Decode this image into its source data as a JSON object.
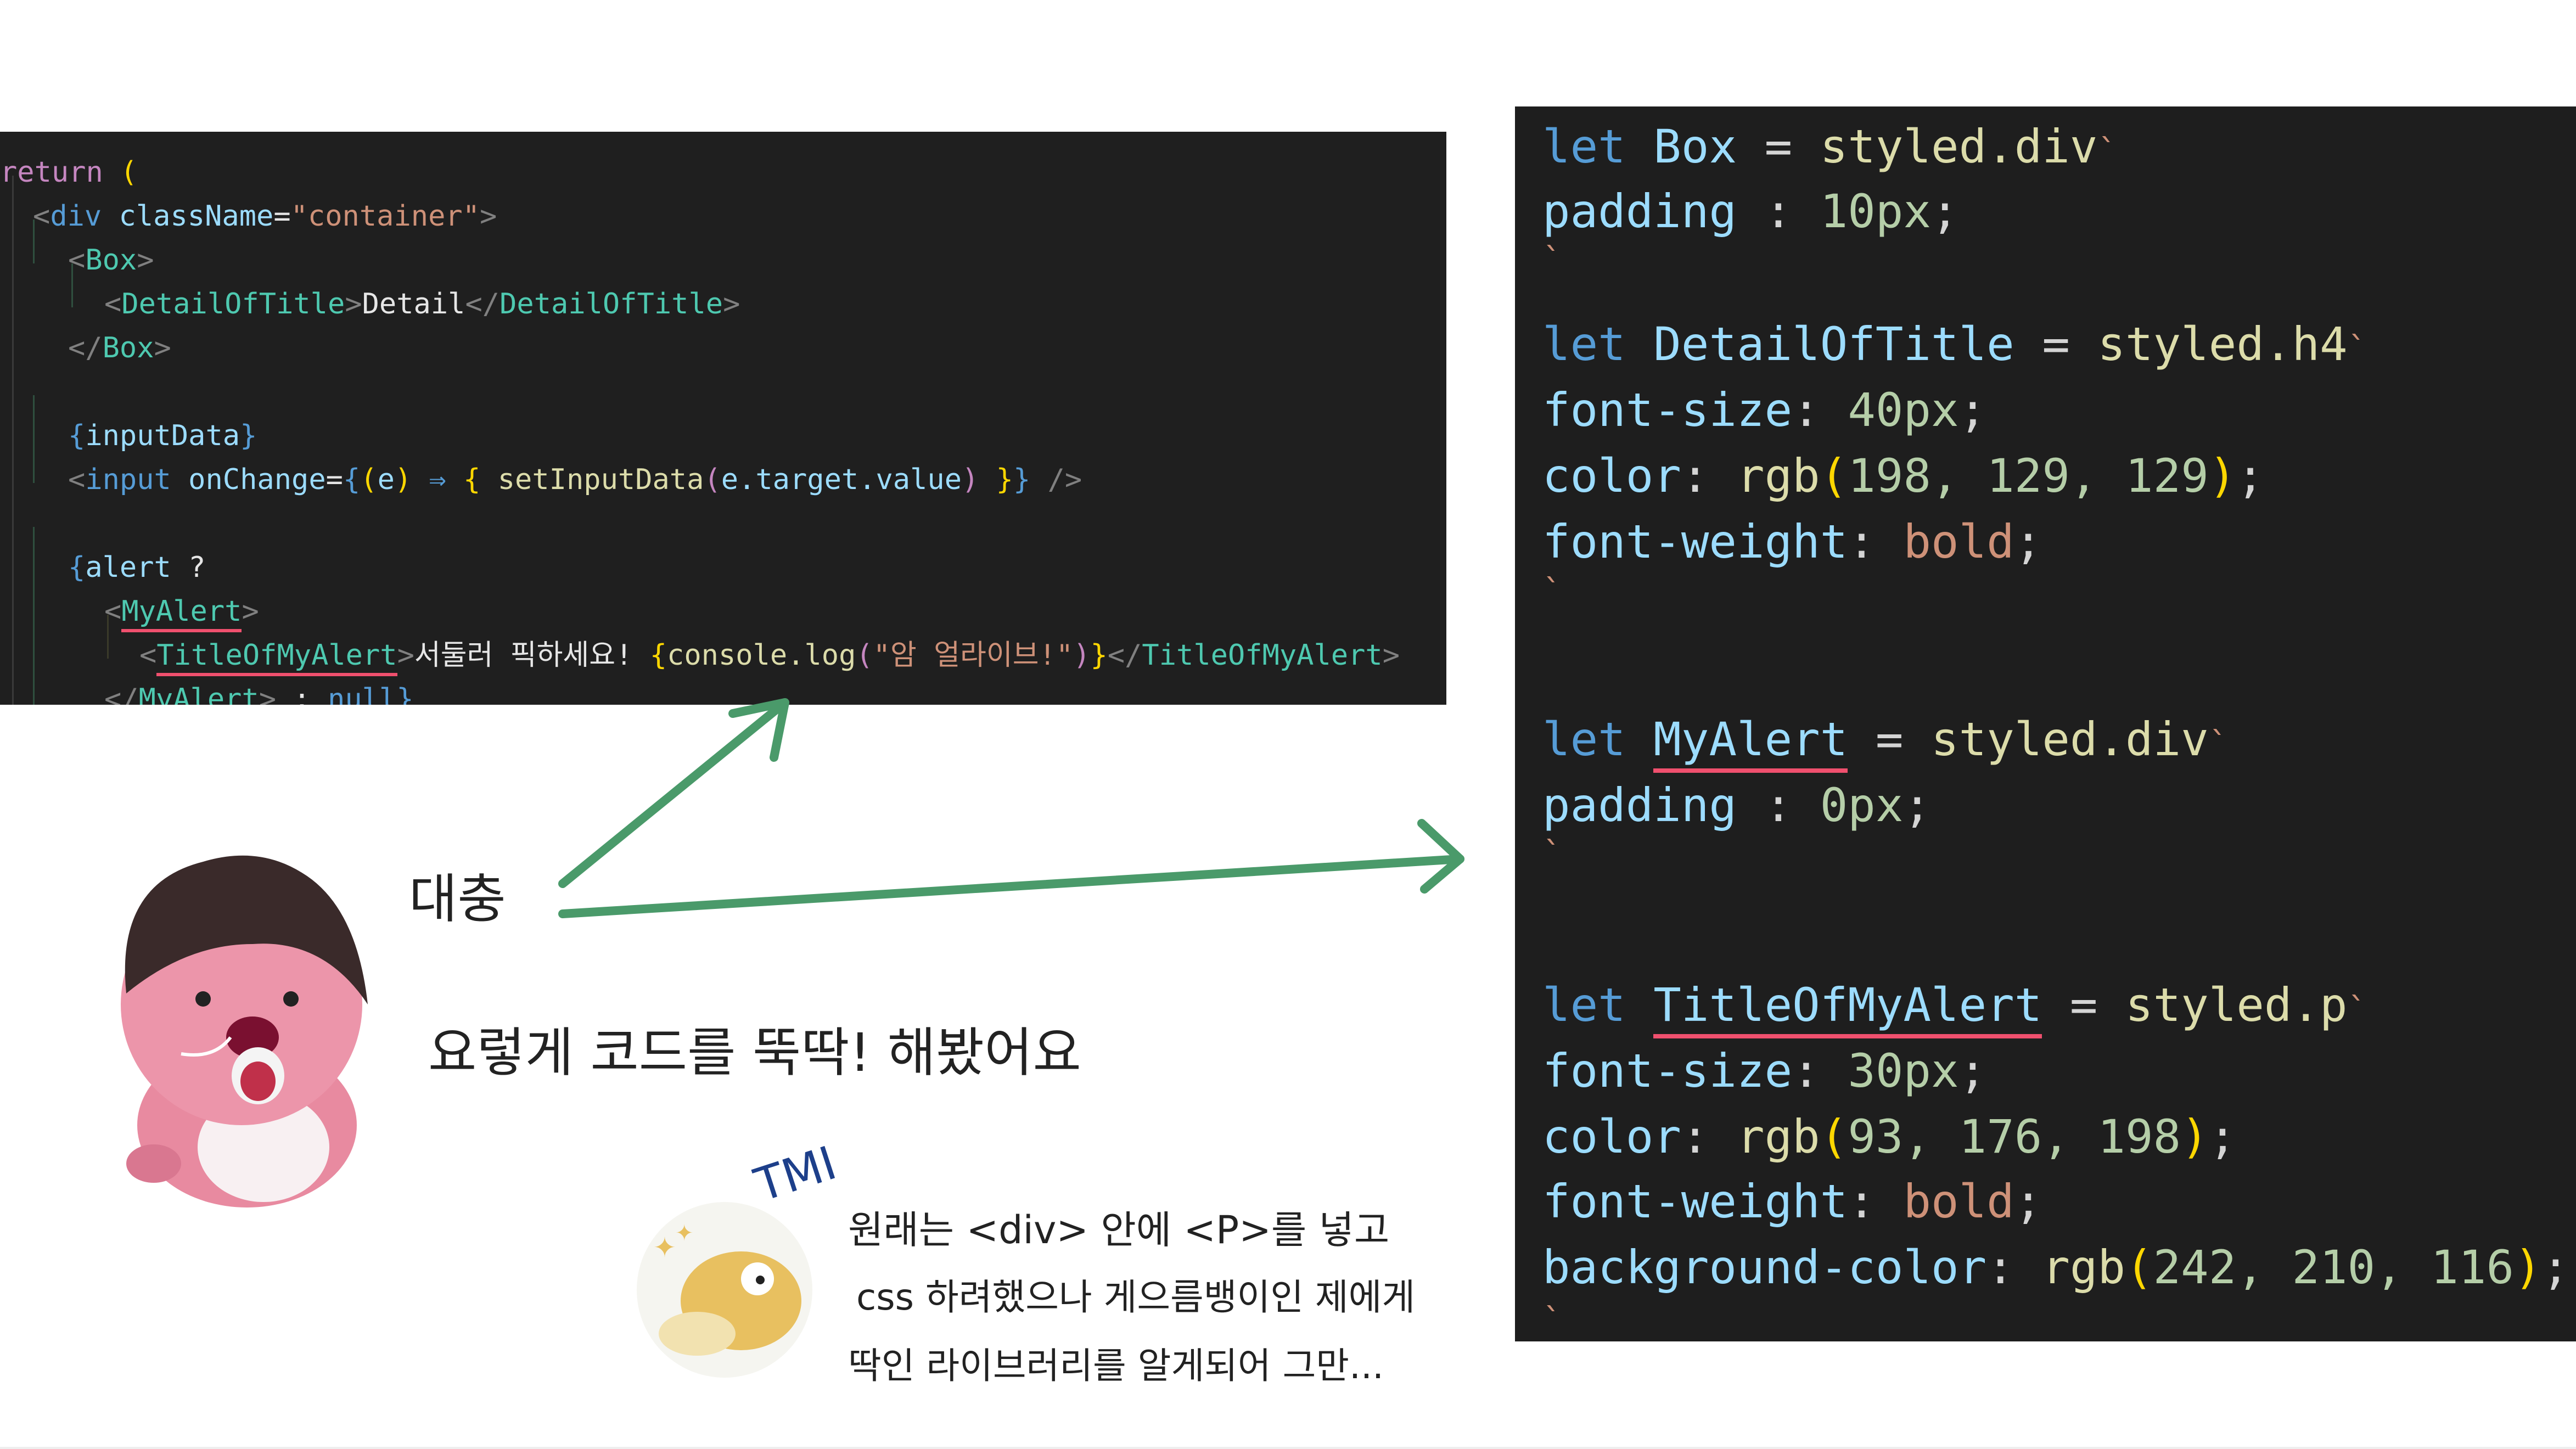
{
  "left_code": {
    "l1_kw": "return",
    "l1_p": " (",
    "l2_open": "<",
    "l2_tag": "div",
    "l2_attr": " className",
    "l2_eq": "=",
    "l2_str": "\"container\"",
    "l2_close": ">",
    "l3_open": "<",
    "l3_tag": "Box",
    "l3_close": ">",
    "l4_open": "<",
    "l4_tag": "DetailOfTitle",
    "l4_gt": ">",
    "l4_text": "Detail",
    "l4_end_open": "</",
    "l4_end_tag": "DetailOfTitle",
    "l4_end_close": ">",
    "l5_open": "</",
    "l5_tag": "Box",
    "l5_close": ">",
    "l7_brace": "{",
    "l7_var": "inputData",
    "l7_brace_end": "}",
    "l8_open": "<",
    "l8_tag": "input",
    "l8_attr": " onChange",
    "l8_eq": "=",
    "l8_b1": "{",
    "l8_p1": "(",
    "l8_e": "e",
    "l8_p2": ")",
    "l8_arrow": " ⇒ ",
    "l8_b2": "{ ",
    "l8_fn": "setInputData",
    "l8_p3": "(",
    "l8_arg": "e.target.value",
    "l8_p4": ")",
    "l8_b3": " }",
    "l8_b4": "}",
    "l8_selfclose": " />",
    "l10_brace": "{",
    "l10_var": "alert",
    "l10_q": " ?",
    "l11_open": "<",
    "l11_tag": "MyAlert",
    "l11_close": ">",
    "l12_open": "<",
    "l12_tag": "TitleOfMyAlert",
    "l12_gt": ">",
    "l12_text": "서둘러 픽하세요! ",
    "l12_b1": "{",
    "l12_fn": "console.log",
    "l12_p1": "(",
    "l12_str": "\"암 얼라이브!\"",
    "l12_p2": ")",
    "l12_b2": "}",
    "l12_end_open": "</",
    "l12_end_tag": "TitleOfMyAlert",
    "l12_end_close": ">",
    "l13_open": "</",
    "l13_tag": "MyAlert",
    "l13_close": ">",
    "l13_colon": " : ",
    "l13_null": "null",
    "l13_brace": "}"
  },
  "right_code": {
    "let": "let",
    "box_name": "Box",
    "eq": "=",
    "box_styled": "styled.div",
    "padding_prop": "padding",
    "colon_sp": " : ",
    "box_padding_val": "10px",
    "semi": ";",
    "backtick": "`",
    "detail_name": "DetailOfTitle",
    "detail_styled": "styled.h4",
    "fontsize_prop": "font-size",
    "colon": ": ",
    "detail_fontsize": "40px",
    "color_prop": "color",
    "rgb": "rgb",
    "paren_open": "(",
    "paren_close": ")",
    "detail_rgb_args": "198, 129, 129",
    "fontweight_prop": "font-weight",
    "bold": "bold",
    "myalert_name": "MyAlert",
    "myalert_styled": "styled.div",
    "myalert_padding_val": "0px",
    "title_name": "TitleOfMyAlert",
    "title_styled": "styled.p",
    "title_fontsize": "30px",
    "title_rgb_args": "93, 176, 198",
    "bgcolor_prop": "background-color",
    "title_bg_args": "242, 210, 116"
  },
  "annotations": {
    "label_short": "대충",
    "caption": "요렇게 코드를 뚝딱! 해봤어요",
    "tmi_tag": "TMI",
    "tmi_line1": "원래는 <div> 안에 <P>를 넣고",
    "tmi_line2": "css 하려했으나 게으름뱅이인 제에게",
    "tmi_line3": "딱인 라이브러리를 알게되어 그만..."
  },
  "colors": {
    "arrow": "#4a9a6a",
    "underline": "#f0506e",
    "editor_bg": "#1e1e1e"
  },
  "icons": [
    "beaver-character-icon",
    "duck-character-icon"
  ]
}
